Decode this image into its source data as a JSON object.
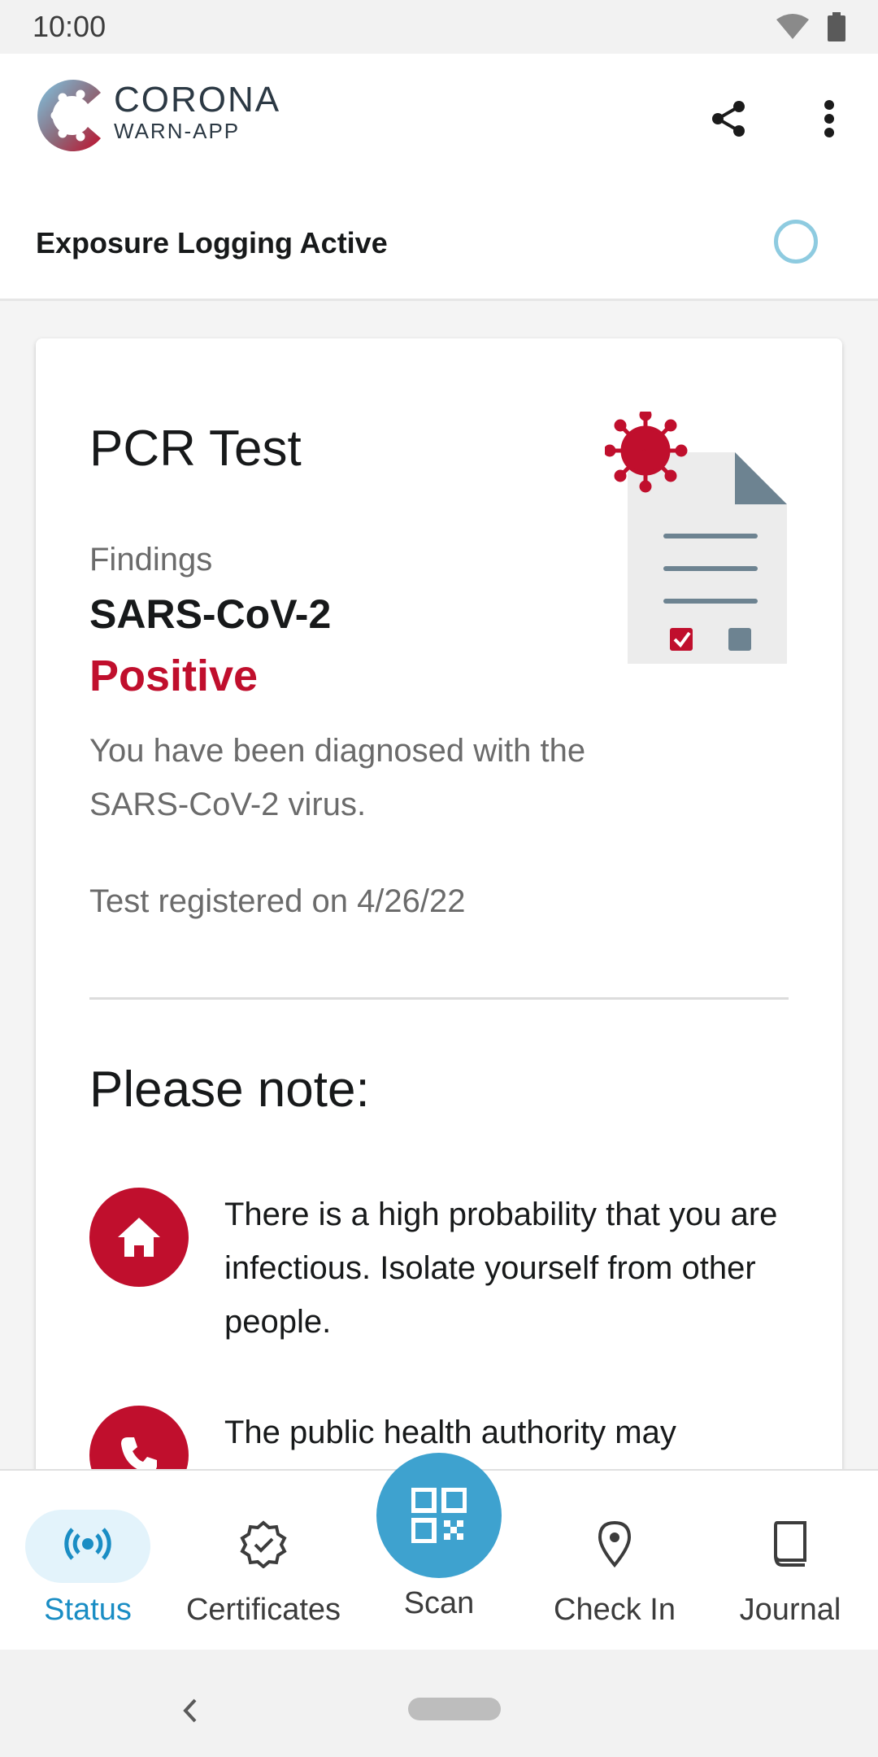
{
  "status_bar": {
    "time": "10:00"
  },
  "app_bar": {
    "logo_title": "CORONA",
    "logo_subtitle": "WARN-APP",
    "share_icon": "share-icon",
    "more_icon": "more-vert-icon"
  },
  "exposure": {
    "label": "Exposure Logging Active"
  },
  "test_card": {
    "title": "PCR Test",
    "findings_label": "Findings",
    "virus": "SARS-CoV-2",
    "result": "Positive",
    "description": "You have been diagnosed with the SARS-CoV-2 virus.",
    "registered": "Test registered on 4/26/22"
  },
  "note": {
    "title": "Please note:",
    "items": [
      {
        "icon": "home-icon",
        "text": "There is a high probability that you are infectious. Isolate yourself from other people."
      },
      {
        "icon": "phone-icon",
        "text": "The public health authority may"
      }
    ]
  },
  "bottom_nav": {
    "items": [
      {
        "label": "Status",
        "icon": "exposure-status-icon",
        "active": true
      },
      {
        "label": "Certificates",
        "icon": "certificate-icon",
        "active": false
      },
      {
        "label": "Scan",
        "icon": "qr-code-icon",
        "active": false
      },
      {
        "label": "Check In",
        "icon": "location-pin-icon",
        "active": false
      },
      {
        "label": "Journal",
        "icon": "journal-book-icon",
        "active": false
      }
    ]
  },
  "colors": {
    "accent": "#c00f2d",
    "primary_blue": "#3ea2cf",
    "active_nav": "#1a8dc4"
  }
}
